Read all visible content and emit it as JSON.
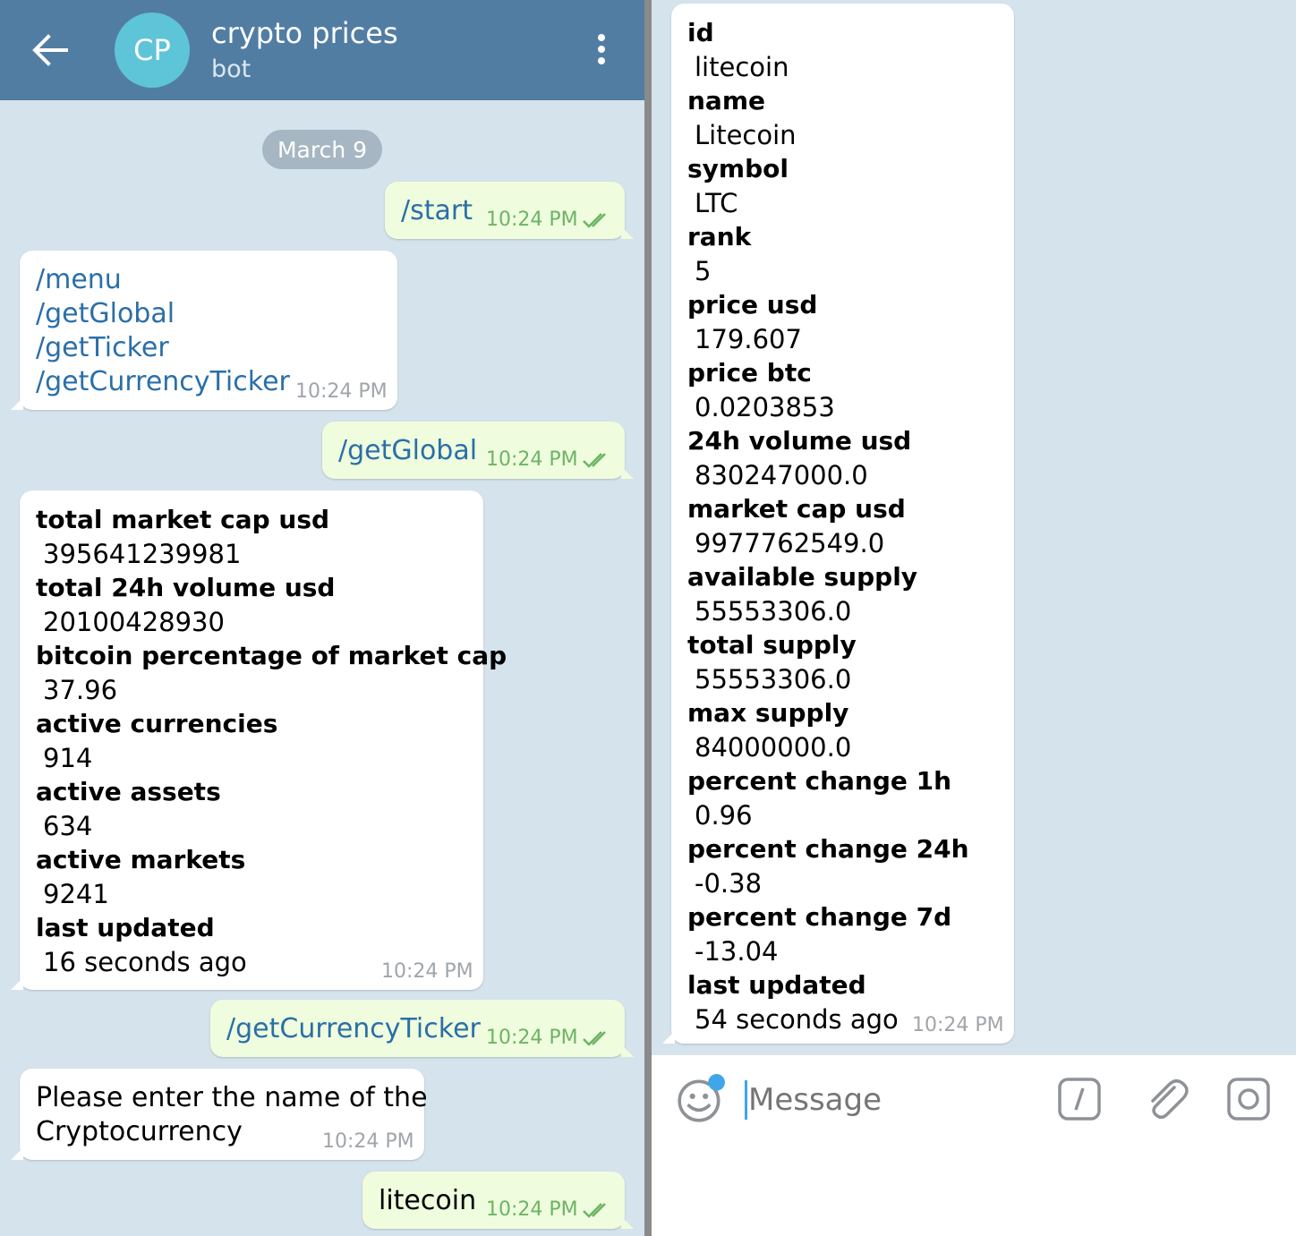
{
  "header": {
    "avatar_initials": "CP",
    "title": "crypto prices",
    "subtitle": "bot"
  },
  "date_divider": "March 9",
  "messages": {
    "start": {
      "text": "/start",
      "time": "10:24 PM"
    },
    "menu": {
      "commands": [
        "/menu",
        "/getGlobal",
        "/getTicker",
        "/getCurrencyTicker"
      ],
      "time": "10:24 PM"
    },
    "get_global": {
      "text": "/getGlobal",
      "time": "10:24 PM"
    },
    "global_stats": {
      "fields": [
        {
          "label": "total market cap usd",
          "value": "395641239981"
        },
        {
          "label": "total 24h volume usd",
          "value": "20100428930"
        },
        {
          "label": "bitcoin percentage of market cap",
          "value": "37.96"
        },
        {
          "label": "active currencies",
          "value": "914"
        },
        {
          "label": "active assets",
          "value": "634"
        },
        {
          "label": "active markets",
          "value": "9241"
        },
        {
          "label": "last updated",
          "value": "16 seconds ago"
        }
      ],
      "time": "10:24 PM"
    },
    "get_currency_ticker": {
      "text": "/getCurrencyTicker",
      "time": "10:24 PM"
    },
    "prompt": {
      "lines": [
        "Please enter the name of the",
        "Cryptocurrency"
      ],
      "time": "10:24 PM"
    },
    "litecoin_cmd": {
      "text": "litecoin",
      "time": "10:24 PM"
    },
    "ticker": {
      "fields": [
        {
          "label": "id",
          "value": "litecoin"
        },
        {
          "label": "name",
          "value": "Litecoin"
        },
        {
          "label": "symbol",
          "value": "LTC"
        },
        {
          "label": "rank",
          "value": "5"
        },
        {
          "label": "price usd",
          "value": "179.607"
        },
        {
          "label": "price btc",
          "value": "0.0203853"
        },
        {
          "label": "24h volume usd",
          "value": "830247000.0"
        },
        {
          "label": "market cap usd",
          "value": "9977762549.0"
        },
        {
          "label": "available supply",
          "value": "55553306.0"
        },
        {
          "label": "total supply",
          "value": "55553306.0"
        },
        {
          "label": "max supply",
          "value": "84000000.0"
        },
        {
          "label": "percent change 1h",
          "value": "0.96"
        },
        {
          "label": "percent change 24h",
          "value": "-0.38"
        },
        {
          "label": "percent change 7d",
          "value": "-13.04"
        },
        {
          "label": "last updated",
          "value": "54 seconds ago"
        }
      ],
      "time": "10:24 PM"
    }
  },
  "input": {
    "placeholder": "Message"
  },
  "icons": {
    "back": "arrow-left-icon",
    "menu": "vertical-dots-icon",
    "read": "double-check-icon",
    "emoji": "smiley-icon",
    "commands": "slash-command-icon",
    "attach": "paperclip-icon",
    "camera": "camera-icon"
  },
  "colors": {
    "header": "#527da3",
    "chat_background": "#d5e3ed",
    "outgoing_bubble": "#effdde",
    "incoming_bubble": "#ffffff",
    "command_link": "#2a6fa8",
    "read_check": "#6cb464",
    "unread_dot": "#3fa6ea"
  }
}
